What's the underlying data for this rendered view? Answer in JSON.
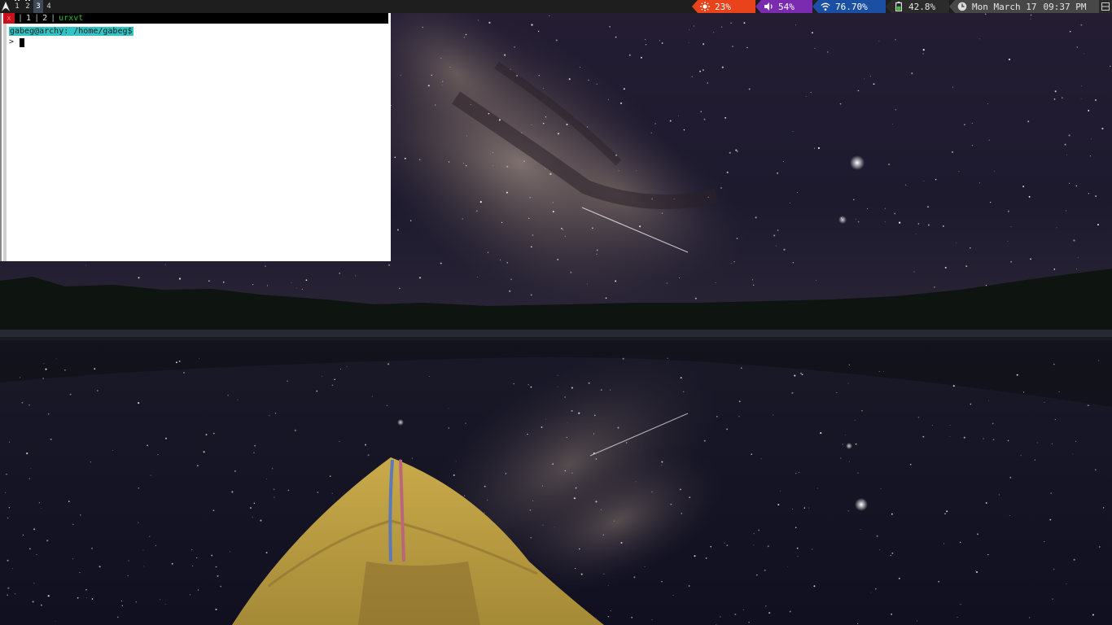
{
  "wallpaper": {
    "description_icon": "milky-way-lake-kayak-wallpaper",
    "colors": {
      "sky": "#1c1830",
      "water": "#15141f",
      "kayak": "#c9a845",
      "treeline": "#0c120e"
    }
  },
  "topbar": {
    "workspaces": [
      {
        "label": "1",
        "active": false,
        "occupied": true
      },
      {
        "label": "2",
        "active": false,
        "occupied": true
      },
      {
        "label": "3",
        "active": true,
        "occupied": false
      },
      {
        "label": "4",
        "active": false,
        "occupied": false
      }
    ],
    "brightness": {
      "icon": "sun-icon",
      "value": "23%",
      "color": "#e8431a"
    },
    "volume": {
      "icon": "speaker-icon",
      "value": "54%",
      "color": "#7a2bb0"
    },
    "wifi": {
      "icon": "wifi-icon",
      "value": "76.70%",
      "color": "#1b4fa4"
    },
    "battery": {
      "icon": "battery-icon",
      "value": "42.8%",
      "color": "#2b2b2b"
    },
    "clock": {
      "icon": "clock-icon",
      "date": "Mon March 17",
      "time": "09:37 PM",
      "color": "#474747"
    }
  },
  "terminal": {
    "close_glyph": "x",
    "tabs": [
      "1",
      "2"
    ],
    "title": "urxvt",
    "prompt": "gabeg@archy: /home/gabeg$",
    "input_prefix": ">"
  }
}
